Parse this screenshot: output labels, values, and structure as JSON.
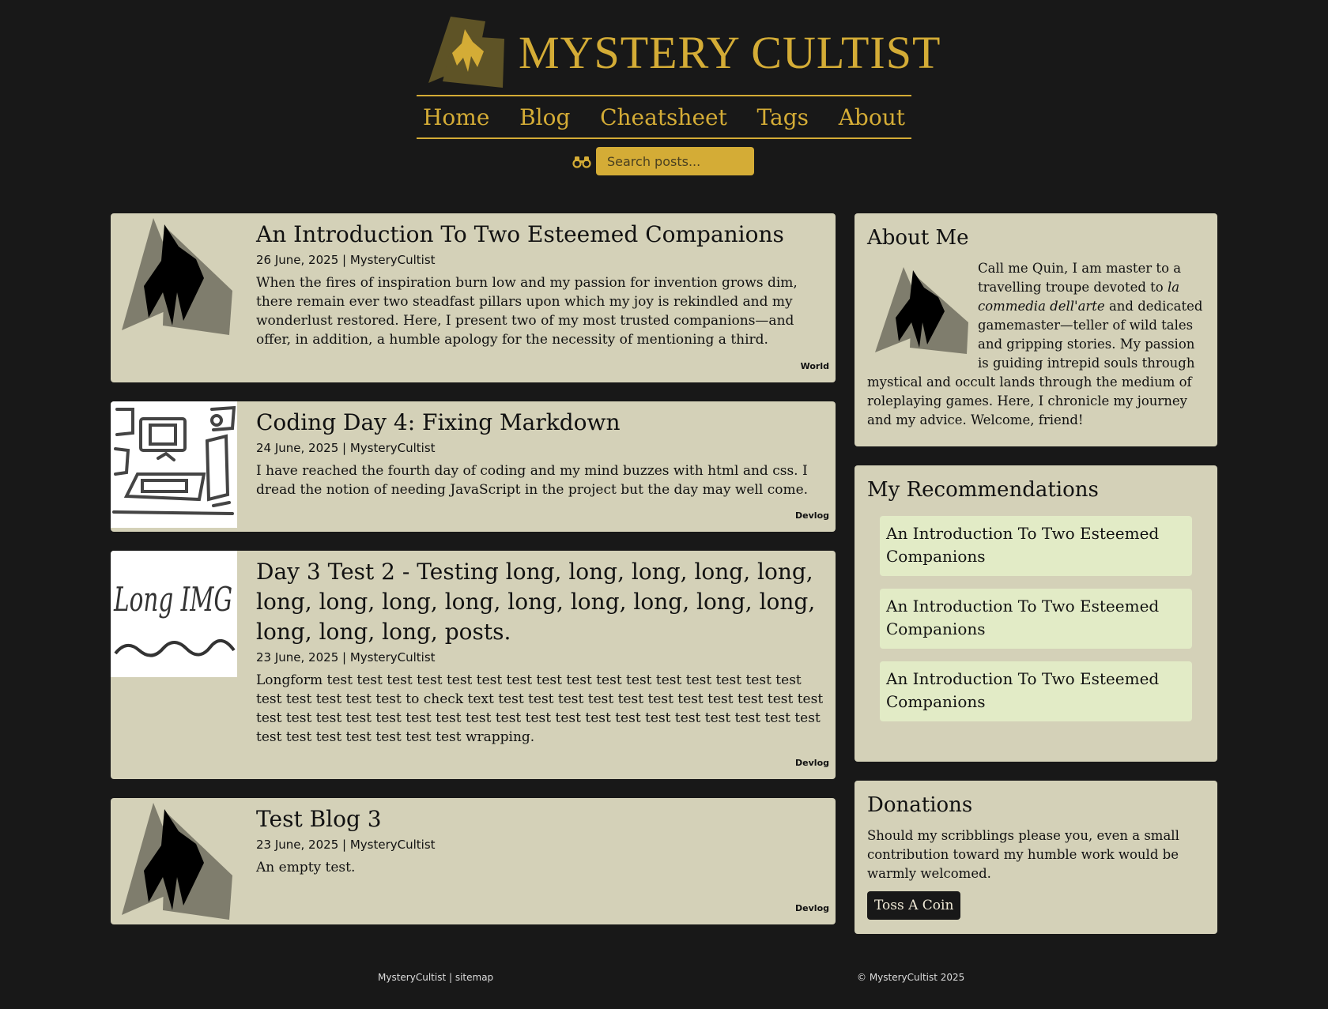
{
  "brand": {
    "title": "MYSTERY CULTIST",
    "logo_icon": "cultist-mask-logo",
    "accent": "#d4ac36"
  },
  "nav": {
    "items": [
      {
        "label": "Home"
      },
      {
        "label": "Blog"
      },
      {
        "label": "Cheatsheet"
      },
      {
        "label": "Tags"
      },
      {
        "label": "About"
      }
    ]
  },
  "search": {
    "icon": "binoculars-icon",
    "placeholder": "Search posts...",
    "value": ""
  },
  "posts": [
    {
      "title": "An Introduction To Two Esteemed Companions",
      "date": "26 June, 2025",
      "author": "MysteryCultist",
      "excerpt": "When the fires of inspiration burn low and my passion for invention grows dim, there remain ever two steadfast pillars upon which my joy is rekindled and my wonderlust restored. Here, I present two of my most trusted companions—and offer, in addition, a humble apology for the necessity of mentioning a third.",
      "tag": "World",
      "thumb": "cultist-logo-thumbnail"
    },
    {
      "title": "Coding Day 4: Fixing Markdown",
      "date": "24 June, 2025",
      "author": "MysteryCultist",
      "excerpt": "I have reached the fourth day of coding and my mind buzzes with html and css. I dread the notion of needing JavaScript in the project but the day may well come.",
      "tag": "Devlog",
      "thumb": "sketch-computer-thumbnail"
    },
    {
      "title": "Day 3 Test 2 - Testing long, long, long, long, long, long, long, long, long, long, long, long, long, long, long, long, long, posts.",
      "date": "23 June, 2025",
      "author": "MysteryCultist",
      "excerpt": "Longform test test test test test test test test test test test test test test test test test test test test test to check text test test test test test test test test test test test test test test test test test test test test test test test test test test test test test test test test test test test test test wrapping.",
      "tag": "Devlog",
      "thumb": "long-img-thumbnail",
      "thumb_text": "Long IMG"
    },
    {
      "title": "Test Blog 3",
      "date": "23 June, 2025",
      "author": "MysteryCultist",
      "excerpt": "An empty test.",
      "tag": "Devlog",
      "thumb": "cultist-logo-thumbnail"
    }
  ],
  "sidebar": {
    "about": {
      "title": "About Me",
      "text_before": "Call me Quin, I am master to a travelling troupe devoted to ",
      "text_em": "la commedia dell'arte",
      "text_after": " and dedicated gamemaster—teller of wild tales and gripping stories. My passion is guiding intrepid souls through mystical and occult lands through the medium of roleplaying games. Here, I chronicle my journey and my advice. Welcome, friend!"
    },
    "recommendations": {
      "title": "My Recommendations",
      "items": [
        {
          "label": "An Introduction To Two Esteemed Companions"
        },
        {
          "label": "An Introduction To Two Esteemed Companions"
        },
        {
          "label": "An Introduction To Two Esteemed Companions"
        }
      ]
    },
    "donations": {
      "title": "Donations",
      "text": "Should my scribblings please you, even a small contribution toward my humble work would be warmly welcomed.",
      "button_label": "Toss A Coin"
    }
  },
  "footer": {
    "site_name": "MysteryCultist",
    "separator": " | ",
    "sitemap_label": "sitemap",
    "copyright": "© MysteryCultist 2025"
  }
}
